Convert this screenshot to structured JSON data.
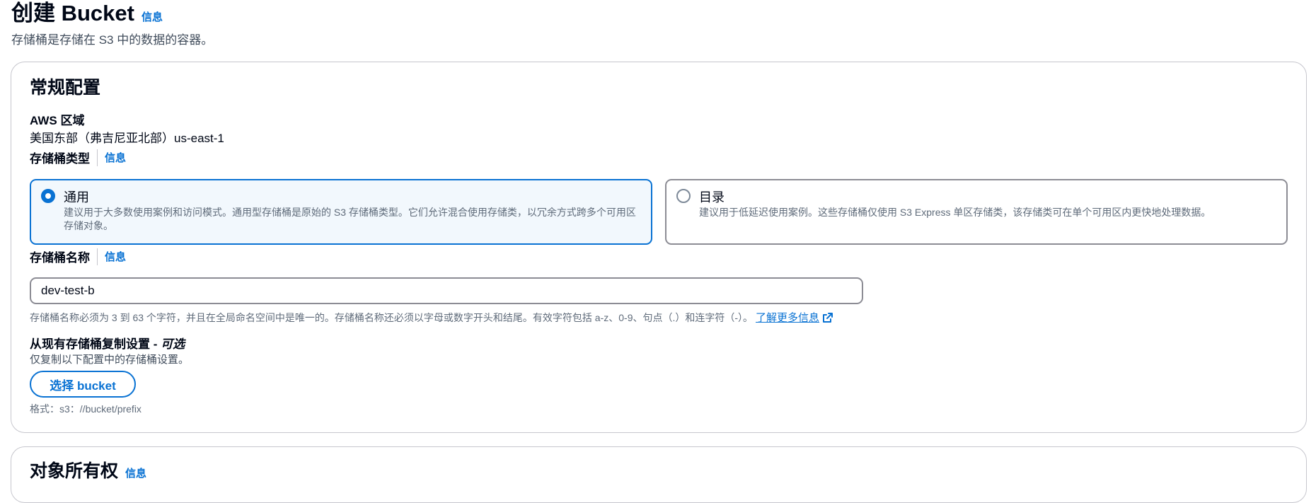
{
  "header": {
    "title": "创建 Bucket",
    "info": "信息",
    "description": "存储桶是存储在 S3 中的数据的容器。"
  },
  "general": {
    "section_title": "常规配置",
    "region_label": "AWS 区域",
    "region_value": "美国东部（弗吉尼亚北部）us-east-1",
    "bucket_type_label": "存储桶类型",
    "bucket_type_info": "信息",
    "bucket_types": [
      {
        "title": "通用",
        "description": "建议用于大多数使用案例和访问模式。通用型存储桶是原始的 S3 存储桶类型。它们允许混合使用存储类，以冗余方式跨多个可用区存储对象。",
        "selected": true
      },
      {
        "title": "目录",
        "description": "建议用于低延迟使用案例。这些存储桶仅使用 S3 Express 单区存储类，该存储类可在单个可用区内更快地处理数据。",
        "selected": false
      }
    ],
    "bucket_name_label": "存储桶名称",
    "bucket_name_info": "信息",
    "bucket_name_value": "dev-test-b",
    "bucket_name_constraint": "存储桶名称必须为 3 到 63 个字符，并且在全局命名空间中是唯一的。存储桶名称还必须以字母或数字开头和结尾。有效字符包括 a-z、0-9、句点（.）和连字符（-）。",
    "learn_more": "了解更多信息",
    "copy_label": "从现有存储桶复制设置 - ",
    "copy_optional": "可选",
    "copy_description": "仅复制以下配置中的存储桶设置。",
    "select_bucket_button": "选择 bucket",
    "format_hint": "格式：s3：//bucket/prefix"
  },
  "ownership": {
    "section_title": "对象所有权",
    "info": "信息"
  },
  "colors": {
    "link": "#0972d3",
    "selected_tile_bg": "#f2f8fd",
    "border": "#c6c6cd",
    "text_secondary": "#5f6b7a"
  }
}
